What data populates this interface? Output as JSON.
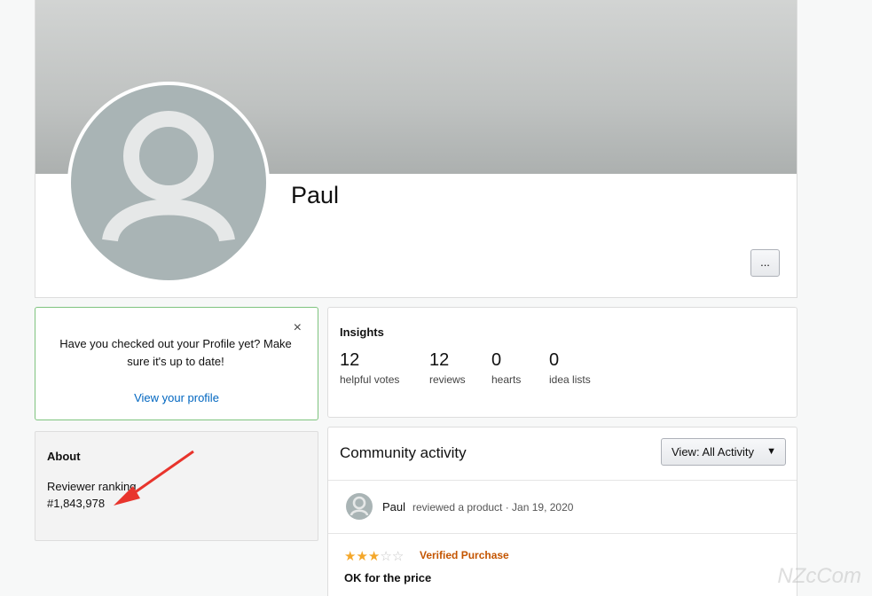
{
  "profile": {
    "name": "Paul",
    "more_label": "..."
  },
  "notice": {
    "close_glyph": "×",
    "text": "Have you checked out your Profile yet? Make sure it's up to date!",
    "link": "View your profile"
  },
  "about": {
    "title": "About",
    "ranking_label": "Reviewer ranking",
    "ranking_value": "#1,843,978"
  },
  "insights": {
    "title": "Insights",
    "stats": [
      {
        "value": "12",
        "label": "helpful votes"
      },
      {
        "value": "12",
        "label": "reviews"
      },
      {
        "value": "0",
        "label": "hearts"
      },
      {
        "value": "0",
        "label": "idea lists"
      }
    ]
  },
  "activity": {
    "title": "Community activity",
    "view_label": "View:",
    "view_value": "All Activity",
    "item": {
      "user": "Paul",
      "meta": "reviewed a product · Jan 19, 2020",
      "rating": 3,
      "rating_max": 5,
      "verified": "Verified Purchase",
      "review_title": "OK for the price"
    }
  },
  "colors": {
    "link": "#0066c0",
    "verified": "#c45500",
    "star": "#f4a72a",
    "notice_border": "#7fc47f",
    "annotation_arrow": "#e8342c"
  },
  "watermark": "NZcCom"
}
